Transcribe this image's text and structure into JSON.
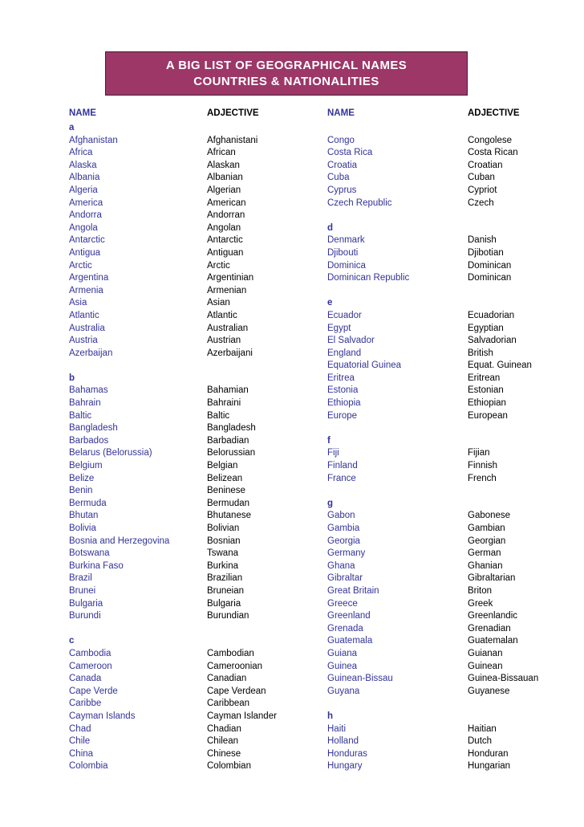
{
  "banner": {
    "line1": "A BIG LIST OF GEOGRAPHICAL NAMES",
    "line2": "COUNTRIES & NATIONALITIES",
    "bg_color": "#9c3768",
    "text_color": "#ffffff"
  },
  "colors": {
    "name_text": "#333399",
    "adjective_text": "#000000",
    "page_bg": "#ffffff"
  },
  "columns": [
    {
      "id": "left",
      "header": {
        "name": "NAME",
        "adjective": "ADJECTIVE"
      },
      "rows": [
        {
          "type": "letter",
          "name": "a",
          "adjective": ""
        },
        {
          "type": "entry",
          "name": "Afghanistan",
          "adjective": "Afghanistani"
        },
        {
          "type": "entry",
          "name": "Africa",
          "adjective": "African"
        },
        {
          "type": "entry",
          "name": "Alaska",
          "adjective": "Alaskan"
        },
        {
          "type": "entry",
          "name": "Albania",
          "adjective": "Albanian"
        },
        {
          "type": "entry",
          "name": "Algeria",
          "adjective": "Algerian"
        },
        {
          "type": "entry",
          "name": "America",
          "adjective": "American"
        },
        {
          "type": "entry",
          "name": "Andorra",
          "adjective": "Andorran"
        },
        {
          "type": "entry",
          "name": "Angola",
          "adjective": "Angolan"
        },
        {
          "type": "entry",
          "name": "Antarctic",
          "adjective": "Antarctic"
        },
        {
          "type": "entry",
          "name": "Antigua",
          "adjective": "Antiguan"
        },
        {
          "type": "entry",
          "name": "Arctic",
          "adjective": "Arctic"
        },
        {
          "type": "entry",
          "name": "Argentina",
          "adjective": "Argentinian"
        },
        {
          "type": "entry",
          "name": "Armenia",
          "adjective": "Armenian"
        },
        {
          "type": "entry",
          "name": "Asia",
          "adjective": "Asian"
        },
        {
          "type": "entry",
          "name": "Atlantic",
          "adjective": "Atlantic"
        },
        {
          "type": "entry",
          "name": "Australia",
          "adjective": "Australian"
        },
        {
          "type": "entry",
          "name": "Austria",
          "adjective": "Austrian"
        },
        {
          "type": "entry",
          "name": "Azerbaijan",
          "adjective": "Azerbaijani"
        },
        {
          "type": "spacer",
          "name": "",
          "adjective": ""
        },
        {
          "type": "letter",
          "name": "b",
          "adjective": ""
        },
        {
          "type": "entry",
          "name": "Bahamas",
          "adjective": "Bahamian"
        },
        {
          "type": "entry",
          "name": "Bahrain",
          "adjective": "Bahraini"
        },
        {
          "type": "entry",
          "name": "Baltic",
          "adjective": "Baltic"
        },
        {
          "type": "entry",
          "name": "Bangladesh",
          "adjective": "Bangladesh"
        },
        {
          "type": "entry",
          "name": "Barbados",
          "adjective": "Barbadian"
        },
        {
          "type": "entry",
          "name": "Belarus (Belorussia)",
          "adjective": "Belorussian"
        },
        {
          "type": "entry",
          "name": "Belgium",
          "adjective": "Belgian"
        },
        {
          "type": "entry",
          "name": "Belize",
          "adjective": "Belizean"
        },
        {
          "type": "entry",
          "name": "Benin",
          "adjective": "Beninese"
        },
        {
          "type": "entry",
          "name": "Bermuda",
          "adjective": "Bermudan"
        },
        {
          "type": "entry",
          "name": "Bhutan",
          "adjective": "Bhutanese"
        },
        {
          "type": "entry",
          "name": "Bolivia",
          "adjective": "Bolivian"
        },
        {
          "type": "entry",
          "name": "Bosnia and Herzegovina",
          "adjective": "Bosnian"
        },
        {
          "type": "entry",
          "name": "Botswana",
          "adjective": "Tswana"
        },
        {
          "type": "entry",
          "name": "Burkina Faso",
          "adjective": "Burkina"
        },
        {
          "type": "entry",
          "name": "Brazil",
          "adjective": "Brazilian"
        },
        {
          "type": "entry",
          "name": "Brunei",
          "adjective": "Bruneian"
        },
        {
          "type": "entry",
          "name": "Bulgaria",
          "adjective": "Bulgaria"
        },
        {
          "type": "entry",
          "name": "Burundi",
          "adjective": "Burundian"
        },
        {
          "type": "spacer",
          "name": "",
          "adjective": ""
        },
        {
          "type": "letter",
          "name": "c",
          "adjective": ""
        },
        {
          "type": "entry",
          "name": "Cambodia",
          "adjective": "Cambodian"
        },
        {
          "type": "entry",
          "name": "Cameroon",
          "adjective": "Cameroonian"
        },
        {
          "type": "entry",
          "name": "Canada",
          "adjective": "Canadian"
        },
        {
          "type": "entry",
          "name": "Cape Verde",
          "adjective": "Cape Verdean"
        },
        {
          "type": "entry",
          "name": "Caribbe",
          "adjective": "Caribbean"
        },
        {
          "type": "entry",
          "name": "Cayman Islands",
          "adjective": "Cayman Islander"
        },
        {
          "type": "entry",
          "name": "Chad",
          "adjective": "Chadian"
        },
        {
          "type": "entry",
          "name": "Chile",
          "adjective": "Chilean"
        },
        {
          "type": "entry",
          "name": "China",
          "adjective": "Chinese"
        },
        {
          "type": "entry",
          "name": "Colombia",
          "adjective": "Colombian"
        }
      ]
    },
    {
      "id": "right",
      "header": {
        "name": "NAME",
        "adjective": "ADJECTIVE"
      },
      "rows": [
        {
          "type": "spacer",
          "name": "",
          "adjective": ""
        },
        {
          "type": "entry",
          "name": "Congo",
          "adjective": "Congolese"
        },
        {
          "type": "entry",
          "name": "Costa Rica",
          "adjective": "Costa Rican"
        },
        {
          "type": "entry",
          "name": "Croatia",
          "adjective": "Croatian"
        },
        {
          "type": "entry",
          "name": "Cuba",
          "adjective": "Cuban"
        },
        {
          "type": "entry",
          "name": "Cyprus",
          "adjective": "Cypriot"
        },
        {
          "type": "entry",
          "name": "Czech Republic",
          "adjective": "Czech"
        },
        {
          "type": "spacer",
          "name": "",
          "adjective": ""
        },
        {
          "type": "letter",
          "name": "d",
          "adjective": ""
        },
        {
          "type": "entry",
          "name": "Denmark",
          "adjective": "Danish"
        },
        {
          "type": "entry",
          "name": "Djibouti",
          "adjective": "Djibotian"
        },
        {
          "type": "entry",
          "name": "Dominica",
          "adjective": "Dominican"
        },
        {
          "type": "entry",
          "name": "Dominican Republic",
          "adjective": "Dominican"
        },
        {
          "type": "spacer",
          "name": "",
          "adjective": ""
        },
        {
          "type": "letter",
          "name": "e",
          "adjective": ""
        },
        {
          "type": "entry",
          "name": "Ecuador",
          "adjective": "Ecuadorian"
        },
        {
          "type": "entry",
          "name": "Egypt",
          "adjective": "Egyptian"
        },
        {
          "type": "entry",
          "name": "El Salvador",
          "adjective": "Salvadorian"
        },
        {
          "type": "entry",
          "name": "England",
          "adjective": "British"
        },
        {
          "type": "entry",
          "name": "Equatorial Guinea",
          "adjective": "Equat. Guinean"
        },
        {
          "type": "entry",
          "name": "Eritrea",
          "adjective": "Eritrean"
        },
        {
          "type": "entry",
          "name": "Estonia",
          "adjective": "Estonian"
        },
        {
          "type": "entry",
          "name": "Ethiopia",
          "adjective": "Ethiopian"
        },
        {
          "type": "entry",
          "name": "Europe",
          "adjective": "European"
        },
        {
          "type": "spacer",
          "name": "",
          "adjective": ""
        },
        {
          "type": "letter",
          "name": "f",
          "adjective": ""
        },
        {
          "type": "entry",
          "name": "Fiji",
          "adjective": "Fijian"
        },
        {
          "type": "entry",
          "name": "Finland",
          "adjective": "Finnish"
        },
        {
          "type": "entry",
          "name": "France",
          "adjective": "French"
        },
        {
          "type": "spacer",
          "name": "",
          "adjective": ""
        },
        {
          "type": "letter",
          "name": "g",
          "adjective": ""
        },
        {
          "type": "entry",
          "name": "Gabon",
          "adjective": "Gabonese"
        },
        {
          "type": "entry",
          "name": "Gambia",
          "adjective": "Gambian"
        },
        {
          "type": "entry",
          "name": "Georgia",
          "adjective": "Georgian"
        },
        {
          "type": "entry",
          "name": "Germany",
          "adjective": "German"
        },
        {
          "type": "entry",
          "name": "Ghana",
          "adjective": "Ghanian"
        },
        {
          "type": "entry",
          "name": "Gibraltar",
          "adjective": "Gibraltarian"
        },
        {
          "type": "entry",
          "name": "Great Britain",
          "adjective": "Briton"
        },
        {
          "type": "entry",
          "name": "Greece",
          "adjective": "Greek"
        },
        {
          "type": "entry",
          "name": "Greenland",
          "adjective": "Greenlandic"
        },
        {
          "type": "entry",
          "name": "Grenada",
          "adjective": "Grenadian"
        },
        {
          "type": "entry",
          "name": "Guatemala",
          "adjective": "Guatemalan"
        },
        {
          "type": "entry",
          "name": "Guiana",
          "adjective": "Guianan"
        },
        {
          "type": "entry",
          "name": "Guinea",
          "adjective": "Guinean"
        },
        {
          "type": "entry",
          "name": "Guinean-Bissau",
          "adjective": "Guinea-Bissauan"
        },
        {
          "type": "entry",
          "name": "Guyana",
          "adjective": "Guyanese"
        },
        {
          "type": "spacer",
          "name": "",
          "adjective": ""
        },
        {
          "type": "letter",
          "name": "h",
          "adjective": ""
        },
        {
          "type": "entry",
          "name": "Haiti",
          "adjective": "Haitian"
        },
        {
          "type": "entry",
          "name": "Holland",
          "adjective": "Dutch"
        },
        {
          "type": "entry",
          "name": "Honduras",
          "adjective": "Honduran"
        },
        {
          "type": "entry",
          "name": "Hungary",
          "adjective": "Hungarian"
        }
      ]
    }
  ]
}
